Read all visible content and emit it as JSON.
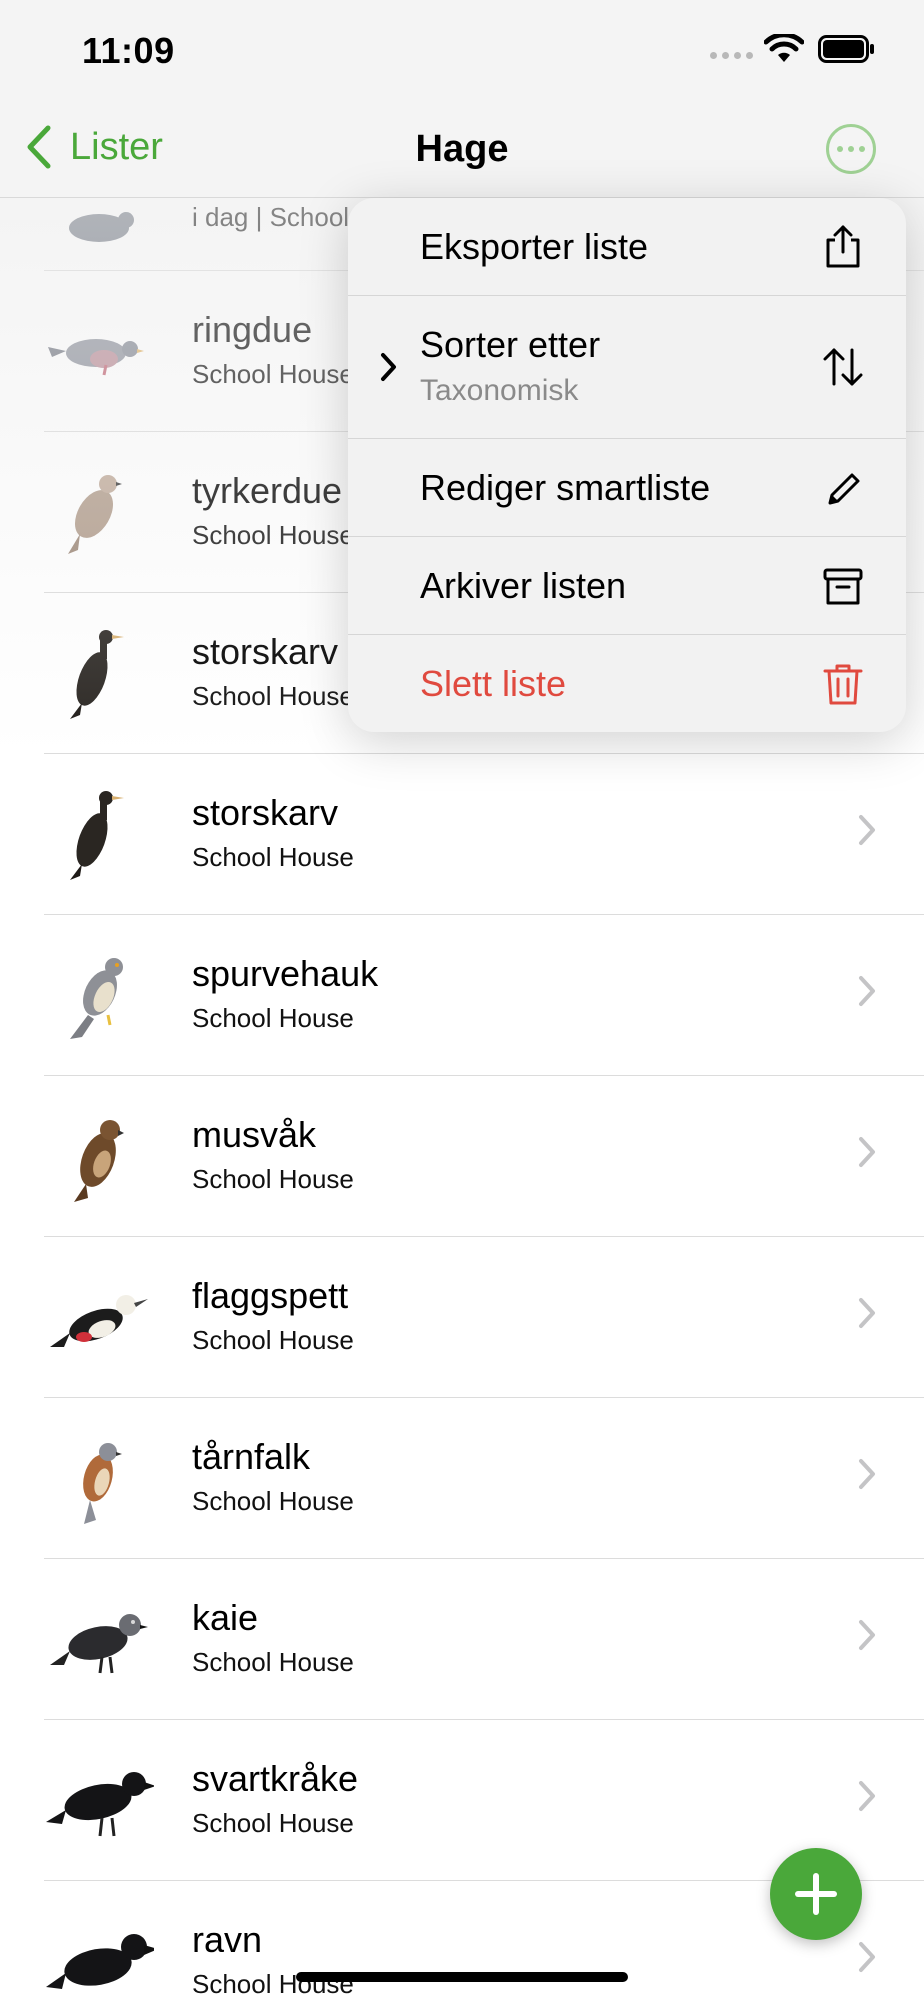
{
  "status": {
    "time": "11:09"
  },
  "nav": {
    "back_label": "Lister",
    "title": "Hage"
  },
  "list": {
    "partial_subtitle": "i dag | School House",
    "items": [
      {
        "name": "ringdue",
        "location": "School House"
      },
      {
        "name": "tyrkerdue",
        "location": "School House"
      },
      {
        "name": "storskarv",
        "location": "School House"
      },
      {
        "name": "storskarv",
        "location": "School House"
      },
      {
        "name": "spurvehauk",
        "location": "School House"
      },
      {
        "name": "musvåk",
        "location": "School House"
      },
      {
        "name": "flaggspett",
        "location": "School House"
      },
      {
        "name": "tårnfalk",
        "location": "School House"
      },
      {
        "name": "kaie",
        "location": "School House"
      },
      {
        "name": "svartkråke",
        "location": "School House"
      },
      {
        "name": "ravn",
        "location": "School House"
      }
    ]
  },
  "menu": {
    "export": {
      "label": "Eksporter liste",
      "icon": "share-icon"
    },
    "sort": {
      "label": "Sorter etter",
      "value": "Taxonomisk",
      "icon": "sort-arrows-icon"
    },
    "edit": {
      "label": "Rediger smartliste",
      "icon": "pencil-icon"
    },
    "archive": {
      "label": "Arkiver listen",
      "icon": "archive-box-icon"
    },
    "delete": {
      "label": "Slett liste",
      "icon": "trash-icon"
    }
  },
  "colors": {
    "accent": "#4aa83a",
    "danger": "#e04a3f",
    "menu_bg": "#f2f2f2"
  }
}
